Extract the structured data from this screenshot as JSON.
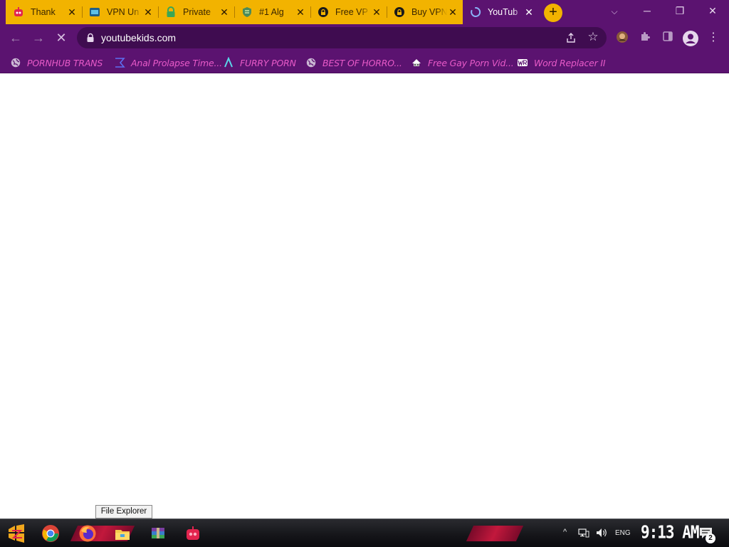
{
  "tabs": [
    {
      "title": "Thank",
      "favicon": "robot-icon",
      "active": false
    },
    {
      "title": "VPN Un",
      "favicon": "vpn-icon",
      "active": false
    },
    {
      "title": "Private",
      "favicon": "lock-icon",
      "active": false
    },
    {
      "title": "#1 Alg",
      "favicon": "shield-icon",
      "active": false
    },
    {
      "title": "Free VP",
      "favicon": "padlock-icon",
      "active": false
    },
    {
      "title": "Buy VPN",
      "favicon": "padlock-icon",
      "active": false
    },
    {
      "title": "YouTub",
      "favicon": "loading-spinner-icon",
      "active": true
    }
  ],
  "new_tab_symbol": "+",
  "window_controls": {
    "minimize": "─",
    "restore": "❐",
    "close": "✕"
  },
  "tab_search_symbol": "⌵",
  "toolbar": {
    "back_symbol": "←",
    "forward_symbol": "→",
    "stop_symbol": "✕",
    "url": "youtubekids.com"
  },
  "bookmarks": [
    {
      "label": "PORNHUB TRANS",
      "icon": "globe-icon"
    },
    {
      "label": "Anal Prolapse Time...",
      "icon": "bracket-icon"
    },
    {
      "label": "FURRY PORN",
      "icon": "lambda-icon"
    },
    {
      "label": "BEST OF HORRO...",
      "icon": "globe-icon"
    },
    {
      "label": "Free Gay Porn Vid...",
      "icon": "hat-icon"
    },
    {
      "label": "Word Replacer II",
      "icon": "wr-icon"
    }
  ],
  "tooltip": "File Explorer",
  "taskbar": {
    "language": "ENG",
    "clock": "9:13 AM",
    "notification_count": "2"
  },
  "colors": {
    "theme": "#5b1370",
    "tab_inactive": "#f2b300",
    "bookmark_text": "#e85ac8",
    "omnibox": "#3f0c50"
  }
}
